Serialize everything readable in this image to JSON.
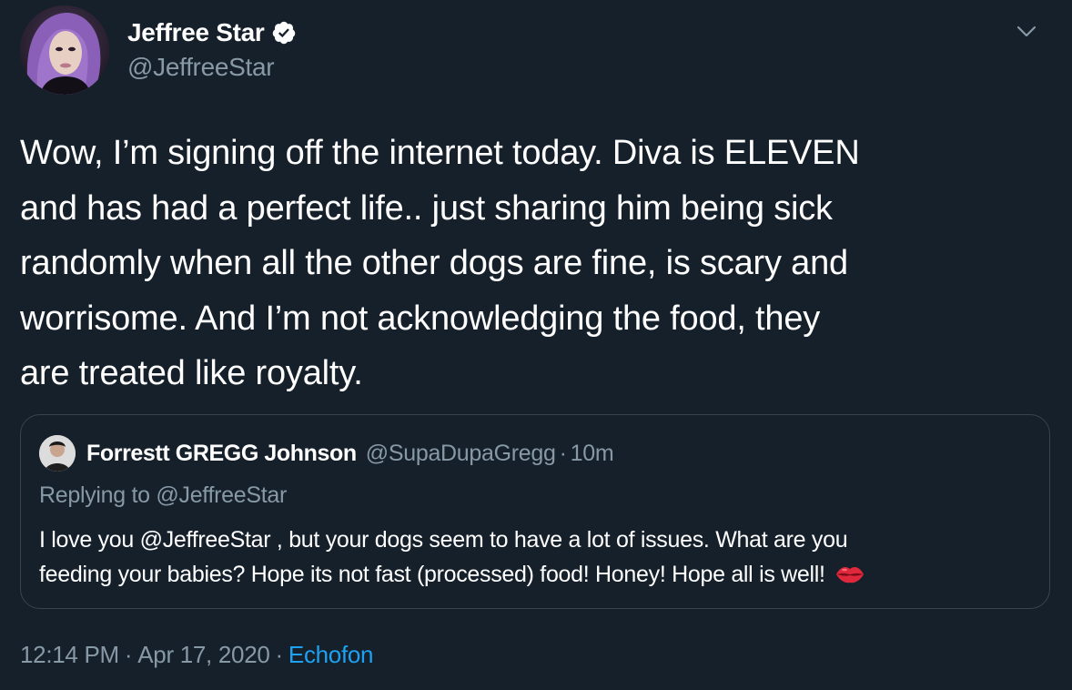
{
  "author": {
    "display_name": "Jeffree Star",
    "handle": "@JeffreeStar",
    "verified": true,
    "avatar_icon": "profile-photo",
    "verified_icon": "verified-badge-icon",
    "menu_icon": "chevron-down-icon"
  },
  "tweet": {
    "text": "Wow, I’m signing off the internet today. Diva is ELEVEN\nand has had a perfect life.. just sharing him being sick\nrandomly when all the other dogs are fine, is scary and\nworrisome. And I’m not acknowledging the food, they\nare treated like royalty."
  },
  "quoted_tweet": {
    "display_name": "Forrestt GREGG Johnson",
    "handle": "@SupaDupaGregg",
    "separator": "·",
    "time": "10m",
    "replying_to": "Replying to @JeffreeStar",
    "text_line1": "I love you @JeffreeStar , but your dogs seem to have a lot of issues.  What are you",
    "text_line2": "feeding your babies? Hope its not fast (processed) food!  Honey! Hope all is well!",
    "emoji_icon": "kiss-lips-icon"
  },
  "footer": {
    "time": "12:14 PM",
    "date": "Apr 17, 2020",
    "separator": "·",
    "source": "Echofon"
  },
  "colors": {
    "background": "#15202b",
    "text_primary": "#ffffff",
    "text_secondary": "#8899a6",
    "link": "#1da1f2",
    "border": "#38444d"
  }
}
